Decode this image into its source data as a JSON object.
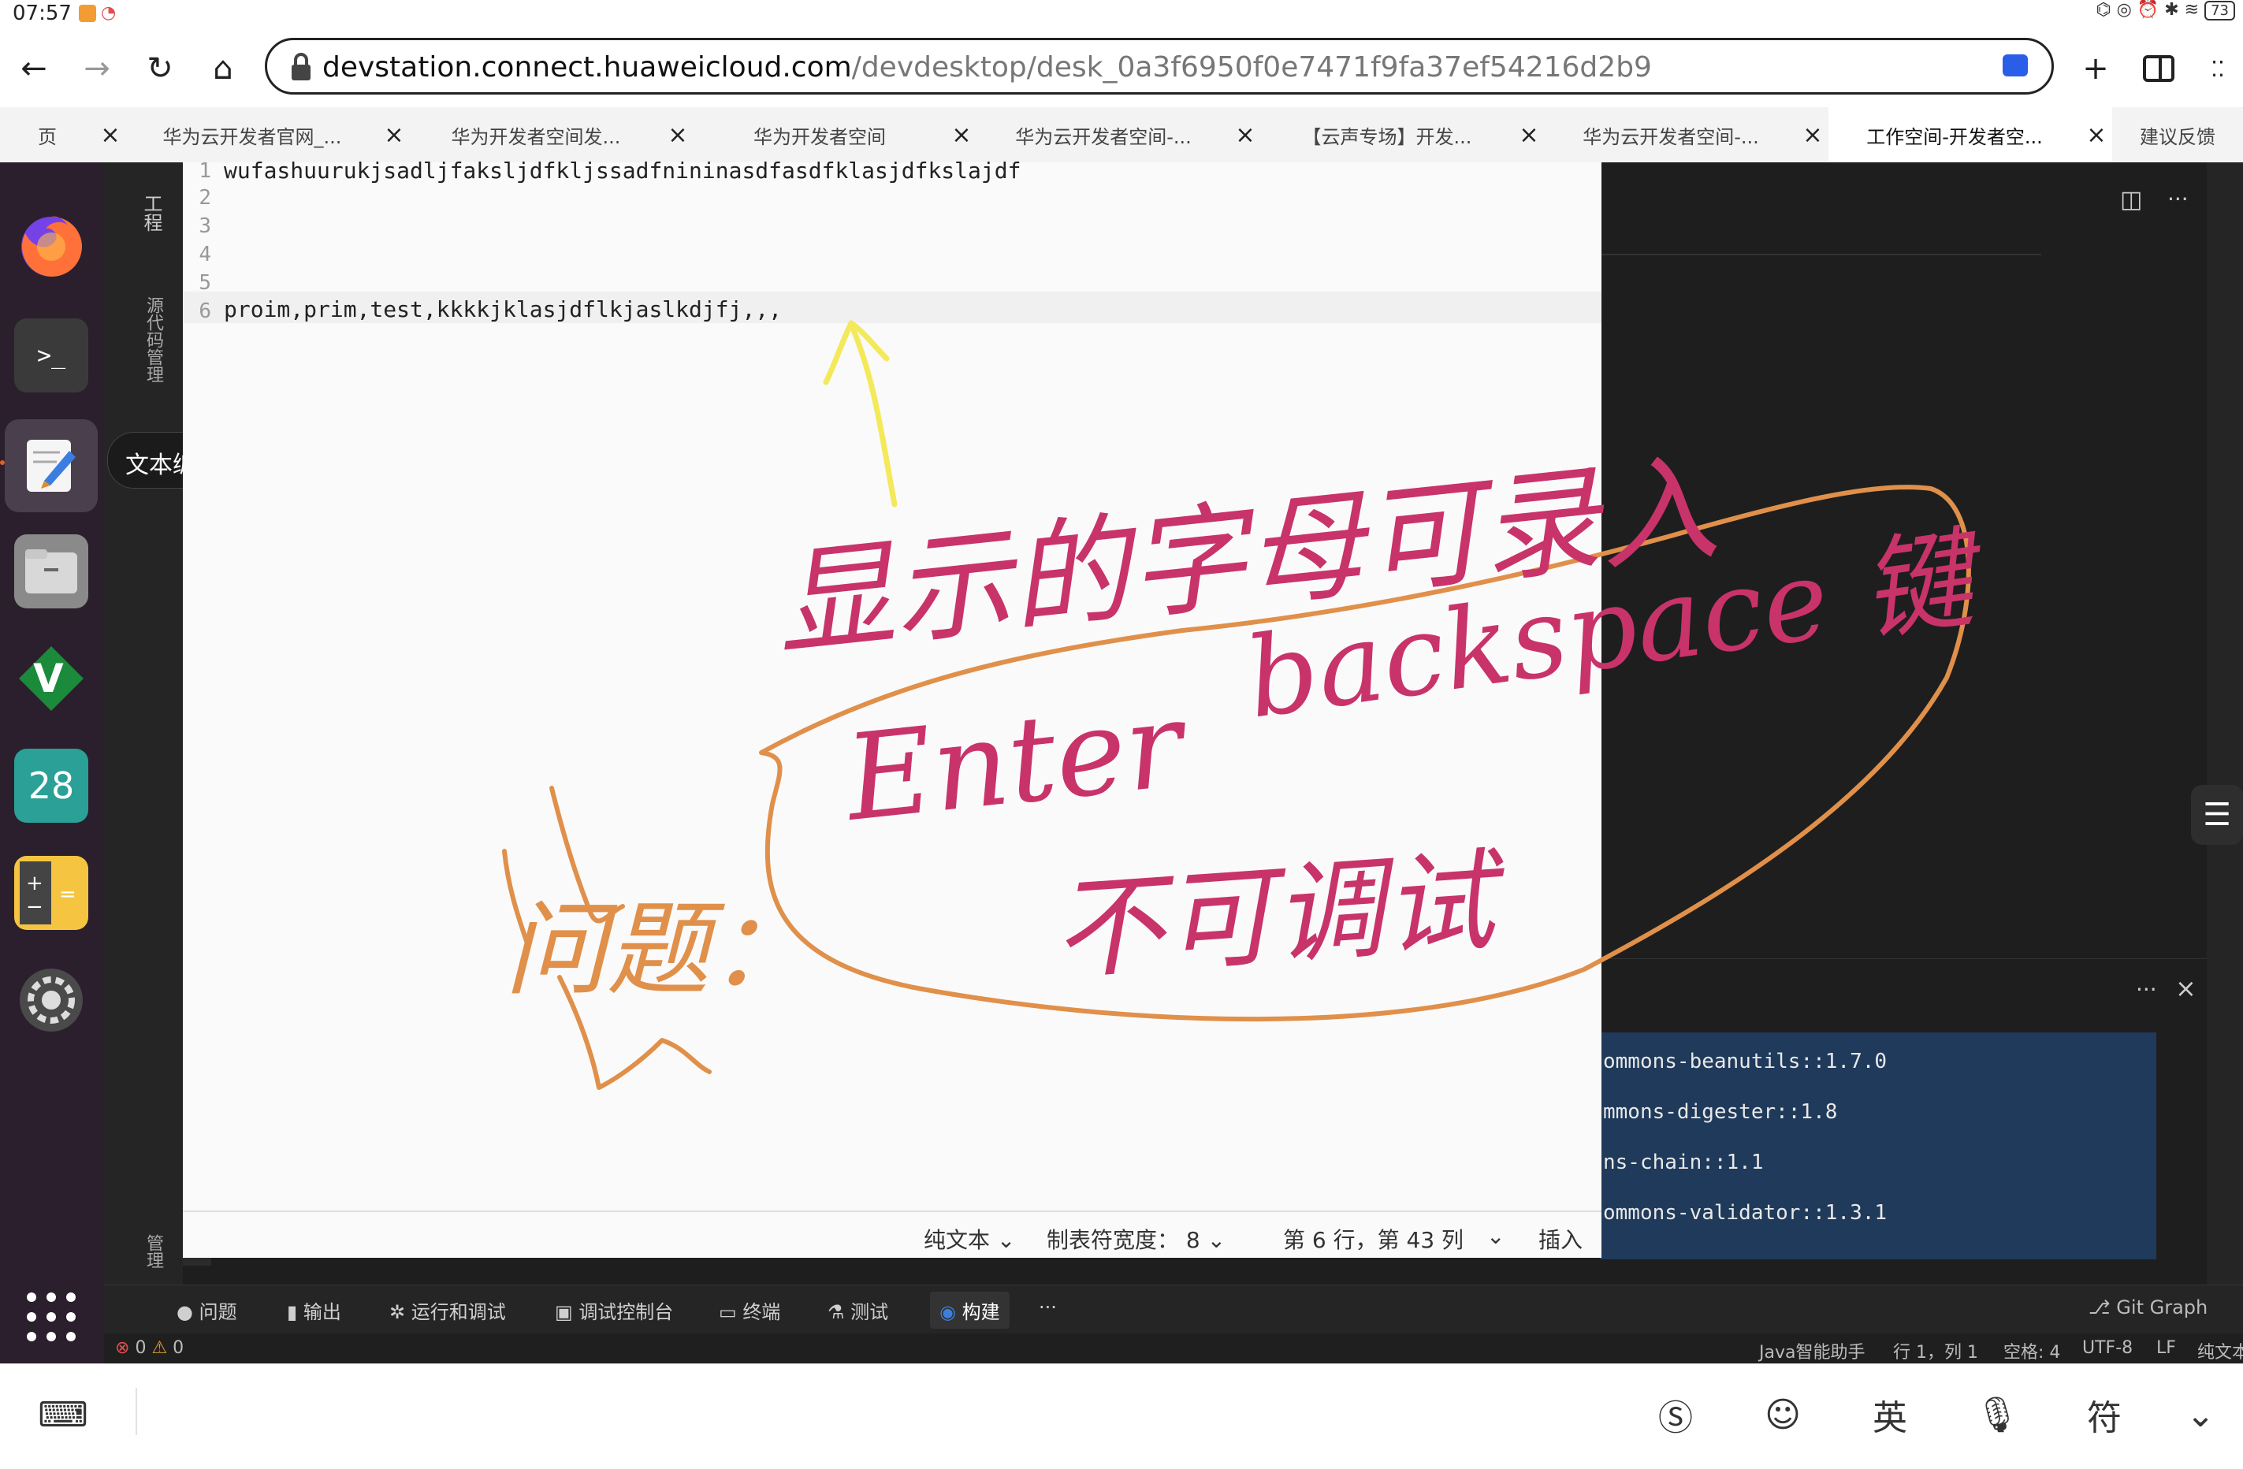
{
  "status_bar": {
    "time": "07:57",
    "battery": "73"
  },
  "browser": {
    "url_host": "devstation.connect.huaweicloud.com",
    "url_path": "/devdesktop/desk_0a3f6950f0e7471f9fa37ef54216d2b9",
    "tabs": [
      {
        "label": "页",
        "active": false
      },
      {
        "label": "华为云开发者官网_...",
        "active": false
      },
      {
        "label": "华为开发者空间发...",
        "active": false
      },
      {
        "label": "华为开发者空间",
        "active": false
      },
      {
        "label": "华为云开发者空间-...",
        "active": false
      },
      {
        "label": "【云声专场】开发...",
        "active": false
      },
      {
        "label": "华为云开发者空间-...",
        "active": false
      },
      {
        "label": "工作空间-开发者空...",
        "active": true
      },
      {
        "label": "建议反馈",
        "active": false
      }
    ]
  },
  "dock": {
    "tooltip": "文本编辑器",
    "calendar_day": "28"
  },
  "editor": {
    "lines": [
      {
        "num": "1",
        "text": "wufashuurukjsadljfaksljdfkljssadfnininasdfasdfklasjdfkslajdf"
      },
      {
        "num": "2",
        "text": ""
      },
      {
        "num": "3",
        "text": ""
      },
      {
        "num": "4",
        "text": ""
      },
      {
        "num": "5",
        "text": ""
      },
      {
        "num": "6",
        "text": "proim,prim,test,kkkkjklasjdflkjaslkdjfj,,,"
      }
    ],
    "status": {
      "language": "纯文本",
      "tab_width": "制表符宽度： 8",
      "position": "第 6 行，第 43 列",
      "mode": "插入"
    }
  },
  "ide": {
    "side_labels": {
      "project": "工程",
      "source_control": "源代码管理",
      "manage": "管理"
    },
    "console_lines": [
      "ommons-beanutils::1.7.0",
      "mmons-digester::1.8",
      "ns-chain::1.1",
      "ommons-validator::1.3.1"
    ],
    "bottom_tabs": [
      "问题",
      "输出",
      "运行和调试",
      "调试控制台",
      "终端",
      "测试",
      "构建"
    ],
    "git_graph": "Git Graph",
    "status": {
      "errors": "0",
      "warnings": "0",
      "assistant": "Java智能助手",
      "cursor": "行 1，列 1",
      "spaces": "空格: 4",
      "encoding": "UTF-8",
      "eol": "LF",
      "lang": "纯文本"
    }
  },
  "annotations": {
    "note_top": "显示的字母可录入",
    "note_enter": "Enter",
    "note_backspace": "backspace 键",
    "note_bottom": "不可调试",
    "note_question": "问题："
  },
  "ime": {
    "lang_label": "英",
    "symbol_label": "符"
  },
  "colors": {
    "pen_pink": "#c8336a",
    "pen_orange": "#e0904a",
    "pen_yellow": "#f3e95a",
    "accent_blue": "#2a5ee8"
  }
}
